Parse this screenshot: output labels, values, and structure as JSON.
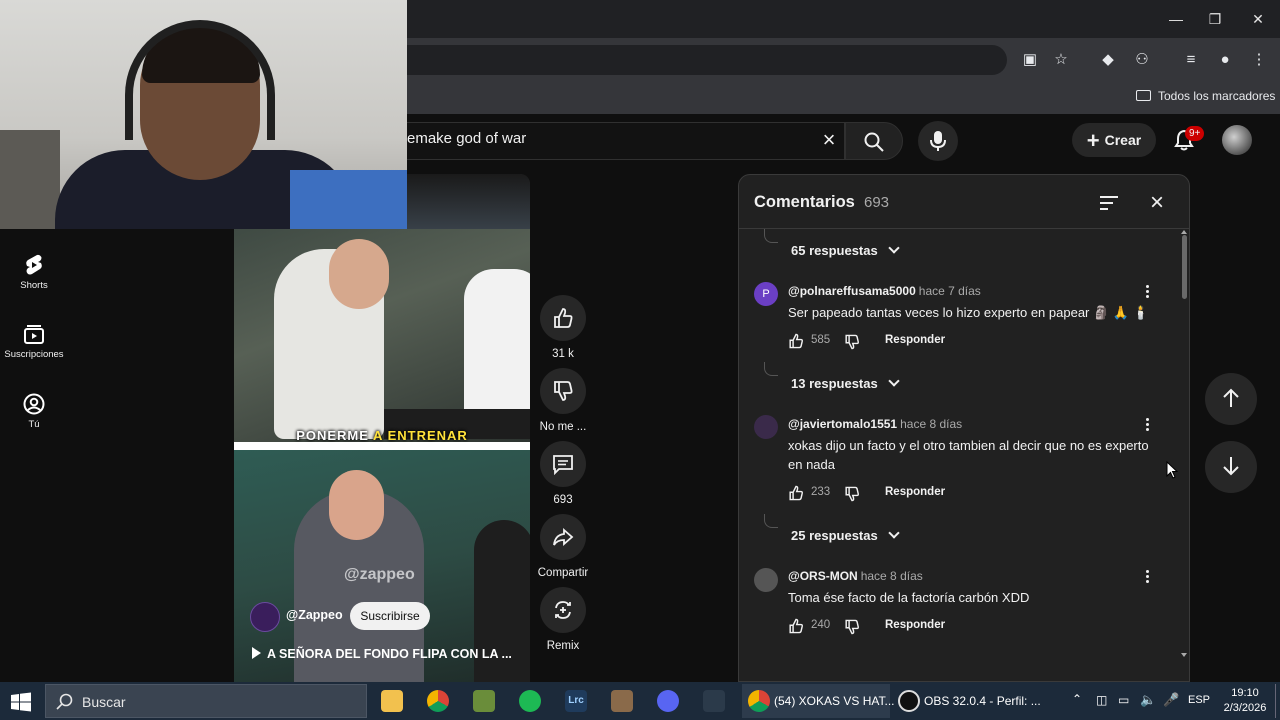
{
  "browser": {
    "bookmarks_folder": "Todos los marcadores"
  },
  "webcam": {},
  "left_nav": {
    "items": [
      {
        "label": "Shorts",
        "icon": "shorts-icon"
      },
      {
        "label": "Suscripciones",
        "icon": "subscriptions-icon"
      },
      {
        "label": "Tú",
        "icon": "you-icon"
      }
    ]
  },
  "header": {
    "search_value": "emake god of war",
    "create_label": "Crear",
    "notification_badge": "9+"
  },
  "short": {
    "caption_pre": "PONERME ",
    "caption_highlight": "A ENTRENAR",
    "watermark": "@zappeo",
    "channel": "@Zappeo",
    "subscribe_label": "Suscribirse",
    "title": "A SEÑORA DEL FONDO FLIPA CON LA ..."
  },
  "actions": {
    "likes": "31 k",
    "dislike_label": "No me ...",
    "comments_count": "693",
    "share_label": "Compartir",
    "remix_label": "Remix"
  },
  "comments": {
    "title": "Comentarios",
    "count": "693",
    "threads": [
      {
        "replies": "65 respuestas"
      },
      {
        "avatar_letter": "P",
        "avatar_color": "#6b3fc4",
        "user": "@polnareffusama5000",
        "time": "hace 7 días",
        "text": "Ser papeado tantas veces lo hizo experto en papear 🗿 🙏 🕯️",
        "likes": "585",
        "reply_label": "Responder",
        "replies": "13 respuestas"
      },
      {
        "avatar_letter": "",
        "avatar_color": "#3a2a4a",
        "user": "@javiertomalo1551",
        "time": "hace 8 días",
        "text": "xokas dijo un facto  y el otro tambien al decir que no es experto en nada",
        "likes": "233",
        "reply_label": "Responder",
        "replies": "25 respuestas"
      },
      {
        "avatar_letter": "",
        "avatar_color": "#555555",
        "user": "@ORS-MON",
        "time": "hace 8 días",
        "text": "Toma ése facto de la factoría carbón XDD",
        "likes": "240",
        "reply_label": "Responder"
      }
    ]
  },
  "taskbar": {
    "search_placeholder": "Buscar",
    "windows": [
      {
        "label": "(54) XOKAS VS HAT...",
        "icon": "chrome-icon"
      },
      {
        "label": "OBS 32.0.4 - Perfil: ...",
        "icon": "obs-icon"
      }
    ],
    "language": "ESP",
    "time": "19:10",
    "date": "2/3/2026"
  },
  "colors": {
    "background": "#0f0f0f",
    "panel": "#212121",
    "accent_red": "#cc0000",
    "caption_yellow": "#ffe23a"
  }
}
